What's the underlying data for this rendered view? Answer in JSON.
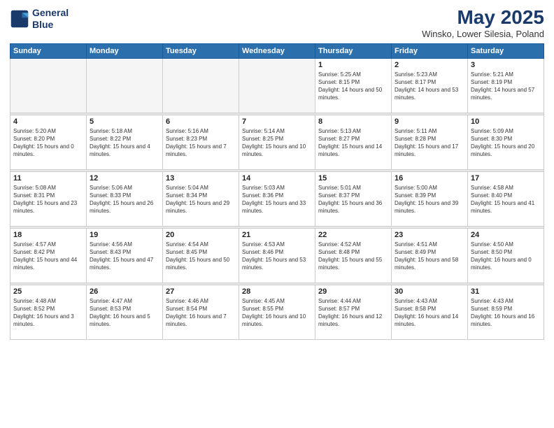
{
  "header": {
    "logo_line1": "General",
    "logo_line2": "Blue",
    "main_title": "May 2025",
    "subtitle": "Winsko, Lower Silesia, Poland"
  },
  "weekdays": [
    "Sunday",
    "Monday",
    "Tuesday",
    "Wednesday",
    "Thursday",
    "Friday",
    "Saturday"
  ],
  "weeks": [
    [
      {
        "day": "",
        "empty": true
      },
      {
        "day": "",
        "empty": true
      },
      {
        "day": "",
        "empty": true
      },
      {
        "day": "",
        "empty": true
      },
      {
        "day": "1",
        "sunrise": "5:25 AM",
        "sunset": "8:15 PM",
        "daylight": "14 hours and 50 minutes."
      },
      {
        "day": "2",
        "sunrise": "5:23 AM",
        "sunset": "8:17 PM",
        "daylight": "14 hours and 53 minutes."
      },
      {
        "day": "3",
        "sunrise": "5:21 AM",
        "sunset": "8:19 PM",
        "daylight": "14 hours and 57 minutes."
      }
    ],
    [
      {
        "day": "4",
        "sunrise": "5:20 AM",
        "sunset": "8:20 PM",
        "daylight": "15 hours and 0 minutes."
      },
      {
        "day": "5",
        "sunrise": "5:18 AM",
        "sunset": "8:22 PM",
        "daylight": "15 hours and 4 minutes."
      },
      {
        "day": "6",
        "sunrise": "5:16 AM",
        "sunset": "8:23 PM",
        "daylight": "15 hours and 7 minutes."
      },
      {
        "day": "7",
        "sunrise": "5:14 AM",
        "sunset": "8:25 PM",
        "daylight": "15 hours and 10 minutes."
      },
      {
        "day": "8",
        "sunrise": "5:13 AM",
        "sunset": "8:27 PM",
        "daylight": "15 hours and 14 minutes."
      },
      {
        "day": "9",
        "sunrise": "5:11 AM",
        "sunset": "8:28 PM",
        "daylight": "15 hours and 17 minutes."
      },
      {
        "day": "10",
        "sunrise": "5:09 AM",
        "sunset": "8:30 PM",
        "daylight": "15 hours and 20 minutes."
      }
    ],
    [
      {
        "day": "11",
        "sunrise": "5:08 AM",
        "sunset": "8:31 PM",
        "daylight": "15 hours and 23 minutes."
      },
      {
        "day": "12",
        "sunrise": "5:06 AM",
        "sunset": "8:33 PM",
        "daylight": "15 hours and 26 minutes."
      },
      {
        "day": "13",
        "sunrise": "5:04 AM",
        "sunset": "8:34 PM",
        "daylight": "15 hours and 29 minutes."
      },
      {
        "day": "14",
        "sunrise": "5:03 AM",
        "sunset": "8:36 PM",
        "daylight": "15 hours and 33 minutes."
      },
      {
        "day": "15",
        "sunrise": "5:01 AM",
        "sunset": "8:37 PM",
        "daylight": "15 hours and 36 minutes."
      },
      {
        "day": "16",
        "sunrise": "5:00 AM",
        "sunset": "8:39 PM",
        "daylight": "15 hours and 39 minutes."
      },
      {
        "day": "17",
        "sunrise": "4:58 AM",
        "sunset": "8:40 PM",
        "daylight": "15 hours and 41 minutes."
      }
    ],
    [
      {
        "day": "18",
        "sunrise": "4:57 AM",
        "sunset": "8:42 PM",
        "daylight": "15 hours and 44 minutes."
      },
      {
        "day": "19",
        "sunrise": "4:56 AM",
        "sunset": "8:43 PM",
        "daylight": "15 hours and 47 minutes."
      },
      {
        "day": "20",
        "sunrise": "4:54 AM",
        "sunset": "8:45 PM",
        "daylight": "15 hours and 50 minutes."
      },
      {
        "day": "21",
        "sunrise": "4:53 AM",
        "sunset": "8:46 PM",
        "daylight": "15 hours and 53 minutes."
      },
      {
        "day": "22",
        "sunrise": "4:52 AM",
        "sunset": "8:48 PM",
        "daylight": "15 hours and 55 minutes."
      },
      {
        "day": "23",
        "sunrise": "4:51 AM",
        "sunset": "8:49 PM",
        "daylight": "15 hours and 58 minutes."
      },
      {
        "day": "24",
        "sunrise": "4:50 AM",
        "sunset": "8:50 PM",
        "daylight": "16 hours and 0 minutes."
      }
    ],
    [
      {
        "day": "25",
        "sunrise": "4:48 AM",
        "sunset": "8:52 PM",
        "daylight": "16 hours and 3 minutes."
      },
      {
        "day": "26",
        "sunrise": "4:47 AM",
        "sunset": "8:53 PM",
        "daylight": "16 hours and 5 minutes."
      },
      {
        "day": "27",
        "sunrise": "4:46 AM",
        "sunset": "8:54 PM",
        "daylight": "16 hours and 7 minutes."
      },
      {
        "day": "28",
        "sunrise": "4:45 AM",
        "sunset": "8:55 PM",
        "daylight": "16 hours and 10 minutes."
      },
      {
        "day": "29",
        "sunrise": "4:44 AM",
        "sunset": "8:57 PM",
        "daylight": "16 hours and 12 minutes."
      },
      {
        "day": "30",
        "sunrise": "4:43 AM",
        "sunset": "8:58 PM",
        "daylight": "16 hours and 14 minutes."
      },
      {
        "day": "31",
        "sunrise": "4:43 AM",
        "sunset": "8:59 PM",
        "daylight": "16 hours and 16 minutes."
      }
    ]
  ]
}
